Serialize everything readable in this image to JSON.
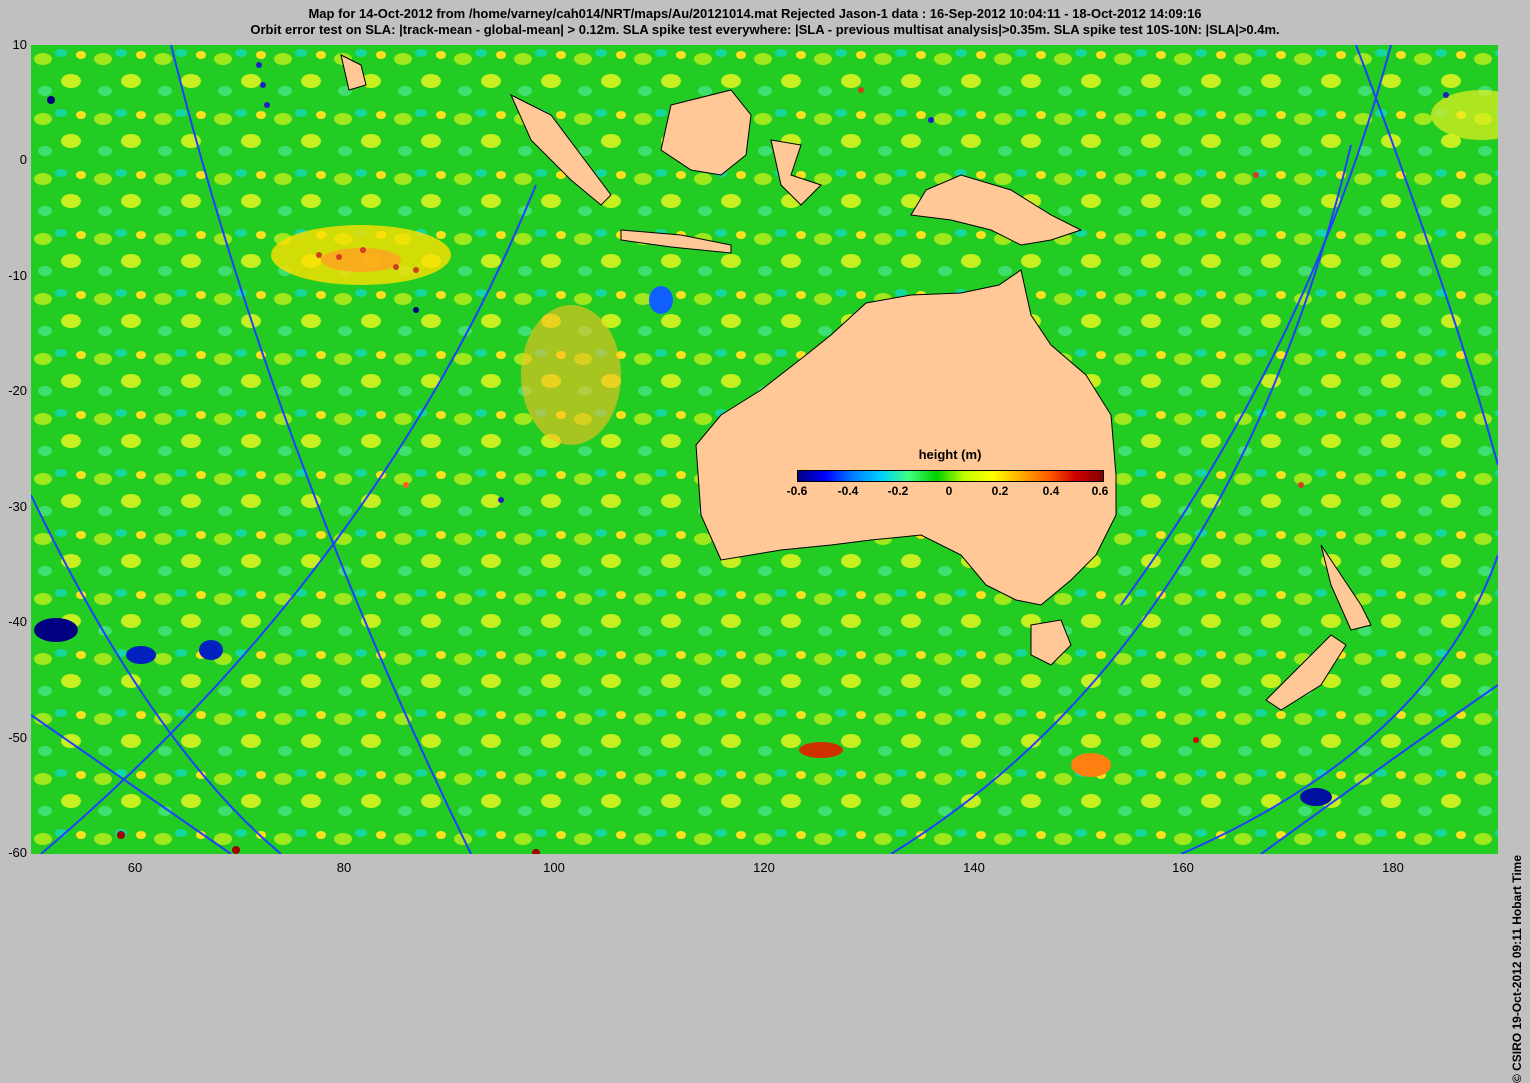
{
  "header": {
    "title_line1": "Map for 14-Oct-2012 from /home/varney/cah014/NRT/maps/Au/20121014.mat  Rejected Jason-1 data : 16-Sep-2012 10:04:11 - 18-Oct-2012 14:09:16",
    "title_line2": "Orbit error test on SLA: |track-mean  - global-mean| > 0.12m.  SLA spike test everywhere: |SLA - previous multisat analysis|>0.35m. SLA spike test 10S-10N: |SLA|>0.4m."
  },
  "axes": {
    "y_ticks": [
      "10",
      "0",
      "-10",
      "-20",
      "-30",
      "-40",
      "-50",
      "-60"
    ],
    "x_ticks": [
      "60",
      "80",
      "100",
      "120",
      "140",
      "160",
      "180"
    ],
    "lon_range": [
      50,
      190
    ],
    "lat_range": [
      -60,
      10
    ]
  },
  "legend": {
    "title": "height (m)",
    "ticks": [
      "-0.6",
      "-0.4",
      "-0.2",
      "0",
      "0.2",
      "0.4",
      "0.6"
    ],
    "range": [
      -0.6,
      0.6
    ]
  },
  "credit": "© CSIRO 19-Oct-2012 09:11 Hobart Time",
  "colors": {
    "background": "#c0c0c0",
    "ocean_base": "#22cc22",
    "land": "#ffc896",
    "track": "#2040ff"
  }
}
